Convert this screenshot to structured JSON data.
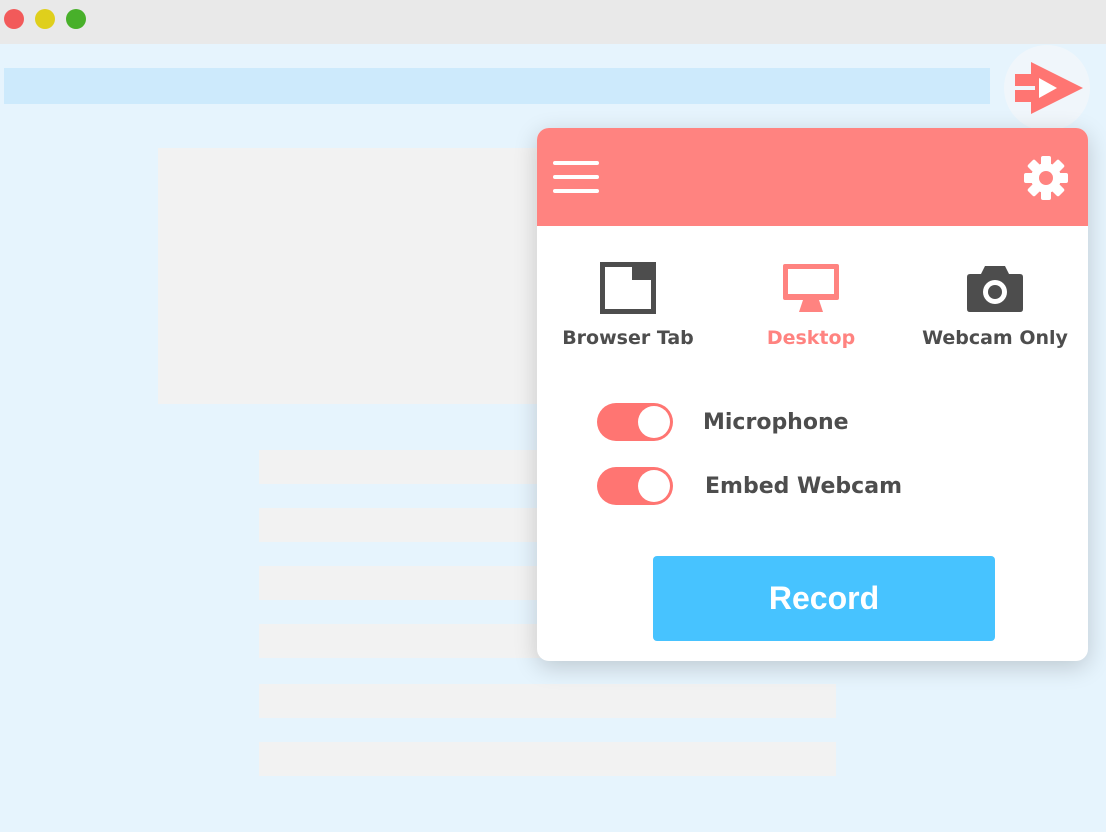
{
  "colors": {
    "traffic_red": "#f25a5a",
    "traffic_yellow": "#dfcf1c",
    "traffic_green": "#48b02a",
    "accent": "#ff8380",
    "toggle_on": "#ff7572",
    "record": "#47c3ff",
    "icon_dark": "#4d4d4d"
  },
  "window": {
    "controls": [
      "close-icon",
      "minimize-icon",
      "maximize-icon"
    ]
  },
  "extension": {
    "icon": "video-camera-play-icon"
  },
  "popup": {
    "header": {
      "menu_icon": "hamburger-menu-icon",
      "settings_icon": "gear-icon"
    },
    "modes": [
      {
        "label": "Browser Tab",
        "icon": "browser-tab-icon",
        "active": false
      },
      {
        "label": "Desktop",
        "icon": "desktop-monitor-icon",
        "active": true
      },
      {
        "label": "Webcam Only",
        "icon": "camera-icon",
        "active": false
      }
    ],
    "toggles": [
      {
        "label": "Microphone",
        "on": true
      },
      {
        "label": "Embed Webcam",
        "on": true
      }
    ],
    "record_label": "Record"
  }
}
